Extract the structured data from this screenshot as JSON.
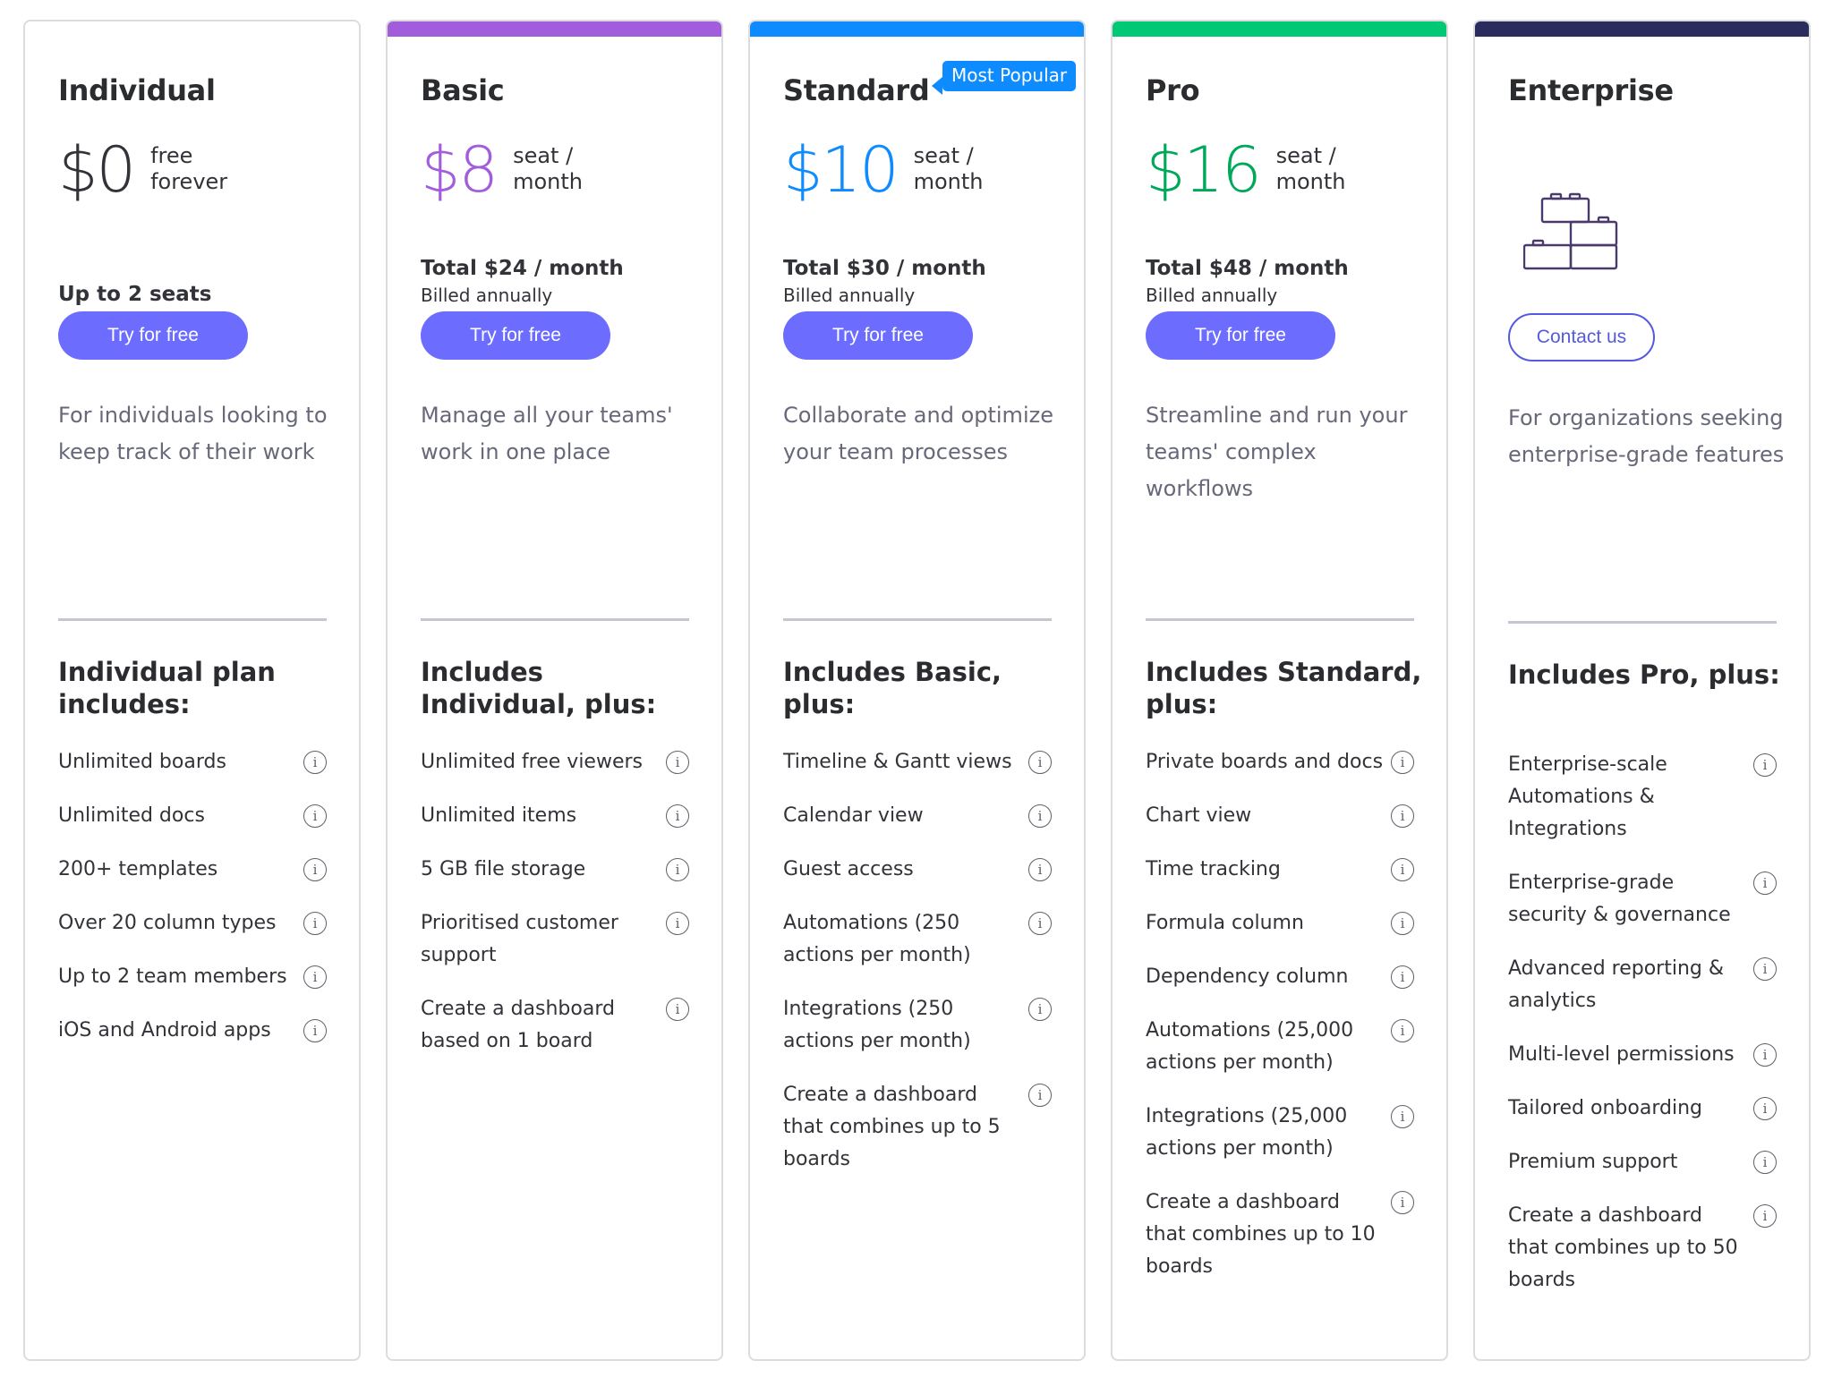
{
  "plans": [
    {
      "id": "individual",
      "name": "Individual",
      "accent": "#323338",
      "topbar": null,
      "price": "$0",
      "price_unit": "free\nforever",
      "seats": "Up to 2 seats",
      "cta": "Try for free",
      "description": "For individuals looking to keep track of their work",
      "includes_heading": "Individual plan includes:",
      "features": [
        "Unlimited boards",
        "Unlimited docs",
        "200+ templates",
        "Over 20 column types",
        "Up to 2 team members",
        "iOS and Android apps"
      ]
    },
    {
      "id": "basic",
      "name": "Basic",
      "accent": "#a25ddc",
      "topbar": "#a25ddc",
      "price": "$8",
      "price_unit": "seat /\nmonth",
      "total": "Total $24 / month",
      "billed": "Billed annually",
      "cta": "Try for free",
      "description": "Manage all your teams' work in one place",
      "includes_heading": "Includes Individual, plus:",
      "features": [
        "Unlimited free viewers",
        "Unlimited items",
        "5 GB file storage",
        "Prioritised customer support",
        "Create a dashboard based on 1 board"
      ]
    },
    {
      "id": "standard",
      "name": "Standard",
      "badge": "Most Popular",
      "accent": "#0d8bff",
      "topbar": "#0d8bff",
      "price": "$10",
      "price_unit": "seat /\nmonth",
      "total": "Total $30 / month",
      "billed": "Billed annually",
      "cta": "Try for free",
      "description": "Collaborate and optimize your team processes",
      "includes_heading": "Includes Basic, plus:",
      "features": [
        "Timeline & Gantt views",
        "Calendar view",
        "Guest access",
        "Automations (250 actions per month)",
        "Integrations (250 actions per month)",
        "Create a dashboard that combines up to 5 boards"
      ]
    },
    {
      "id": "pro",
      "name": "Pro",
      "accent": "#00a85a",
      "topbar": "#00c875",
      "price": "$16",
      "price_unit": "seat /\nmonth",
      "total": "Total $48 / month",
      "billed": "Billed annually",
      "cta": "Try for free",
      "description": "Streamline and run your teams' complex workflows",
      "includes_heading": "Includes Standard, plus:",
      "features": [
        "Private boards and docs",
        "Chart view",
        "Time tracking",
        "Formula column",
        "Dependency column",
        "Automations (25,000 actions per month)",
        "Integrations (25,000 actions per month)",
        "Create a dashboard that combines up to 10 boards"
      ]
    },
    {
      "id": "enterprise",
      "name": "Enterprise",
      "accent": "#323338",
      "topbar": "#2b2c5e",
      "icon": "building-blocks-icon",
      "cta": "Contact us",
      "description": "For organizations seeking enterprise-grade features",
      "includes_heading": "Includes Pro, plus:",
      "features": [
        "Enterprise-scale Automations & Integrations",
        "Enterprise-grade security & governance",
        "Advanced reporting & analytics",
        "Multi-level permissions",
        "Tailored onboarding",
        "Premium support",
        "Create a dashboard that combines up to 50 boards"
      ]
    }
  ],
  "info_icon_glyph": "i"
}
